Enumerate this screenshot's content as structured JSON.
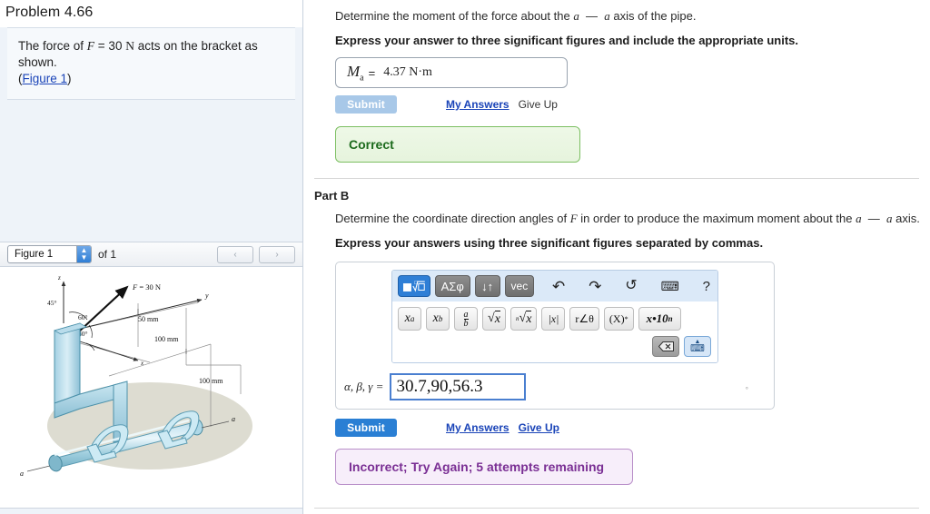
{
  "problem": {
    "title": "Problem 4.66",
    "statement_prefix": "The force of ",
    "statement_F": "F",
    "statement_mid": " = 30 ",
    "statement_unit": "N",
    "statement_suffix": " acts on the bracket as shown.",
    "figure_link_open": "(",
    "figure_link": "Figure 1",
    "figure_link_close": ")"
  },
  "figure_toolbar": {
    "selected_figure": "Figure 1",
    "of_count": "of 1",
    "prev_label": "‹",
    "next_label": "›"
  },
  "figure": {
    "force_label": "F = 30 N",
    "angle_45": "45°",
    "angle_60_upper": "60°",
    "angle_60_lower": "60°",
    "dim_50": "50 mm",
    "dim_100_upper": "100 mm",
    "dim_100_lower": "100 mm",
    "axis_z": "z",
    "axis_y": "y",
    "axis_x": "x",
    "axis_a_right": "a",
    "axis_a_left": "a"
  },
  "part_a": {
    "question_pre": "Determine the moment of the force about the ",
    "question_a1": "a",
    "question_dash": "—",
    "question_a2": "a",
    "question_post": " axis of the pipe.",
    "instruction": "Express your answer to three significant figures and include the appropriate units.",
    "answer_symbol": "M",
    "answer_subscript": "a",
    "answer_equals": "=",
    "answer_value": "4.37 N·m",
    "submit_label": "Submit",
    "my_answers_label": "My Answers",
    "give_up_label": "Give Up",
    "feedback": "Correct"
  },
  "part_b": {
    "heading": "Part B",
    "question_pre": "Determine the coordinate direction angles of ",
    "question_F": "F",
    "question_mid": " in order to produce the maximum moment about the ",
    "question_a1": "a",
    "question_dash": "—",
    "question_a2": "a",
    "question_post": " axis.",
    "instruction": "Express your answers using three significant figures separated by commas.",
    "answer_label": "α, β, γ =",
    "answer_value": "30.7,90,56.3",
    "degree_mark": "°",
    "submit_label": "Submit",
    "my_answers_label": "My Answers",
    "give_up_label": "Give Up",
    "feedback": "Incorrect; Try Again; 5 attempts remaining"
  },
  "math_toolbar": {
    "row1": [
      {
        "id": "template-root",
        "label": "■√□",
        "selected": true
      },
      {
        "id": "greek",
        "label": "ΑΣφ",
        "selected": false
      },
      {
        "id": "updown",
        "label": "↓↑",
        "selected": false
      },
      {
        "id": "vec",
        "label": "vec",
        "selected": false
      }
    ],
    "row1_icons": [
      {
        "id": "undo-icon",
        "label": "↶"
      },
      {
        "id": "redo-icon",
        "label": "↷"
      },
      {
        "id": "reset-icon",
        "label": "↺"
      },
      {
        "id": "keyboard-icon",
        "label": "⌨"
      },
      {
        "id": "help-icon",
        "label": "?"
      }
    ],
    "row2": [
      {
        "id": "power",
        "label": "xᵃ"
      },
      {
        "id": "subscript",
        "label": "xb"
      },
      {
        "id": "fraction",
        "label": "a/b"
      },
      {
        "id": "sqrt",
        "label": "√x"
      },
      {
        "id": "nthroot",
        "label": "ⁿ√x"
      },
      {
        "id": "absolute",
        "label": "|x|"
      },
      {
        "id": "polar",
        "label": "r∠θ"
      },
      {
        "id": "conjugate",
        "label": "(X)*"
      },
      {
        "id": "scientific",
        "label": "x•10ⁿ"
      }
    ],
    "row3": [
      {
        "id": "backspace-icon",
        "label": "⌫"
      },
      {
        "id": "collapse-keyboard-icon",
        "label": "⌨"
      }
    ]
  },
  "colors": {
    "submit_active": "#2a7fd4",
    "submit_disabled": "#a8c8e8",
    "link": "#1a44b8",
    "correct_text": "#1d6b1d",
    "incorrect_text": "#7a2f94",
    "panel_bg": "#eef3f9",
    "pad_header": "#dbe9f8"
  }
}
